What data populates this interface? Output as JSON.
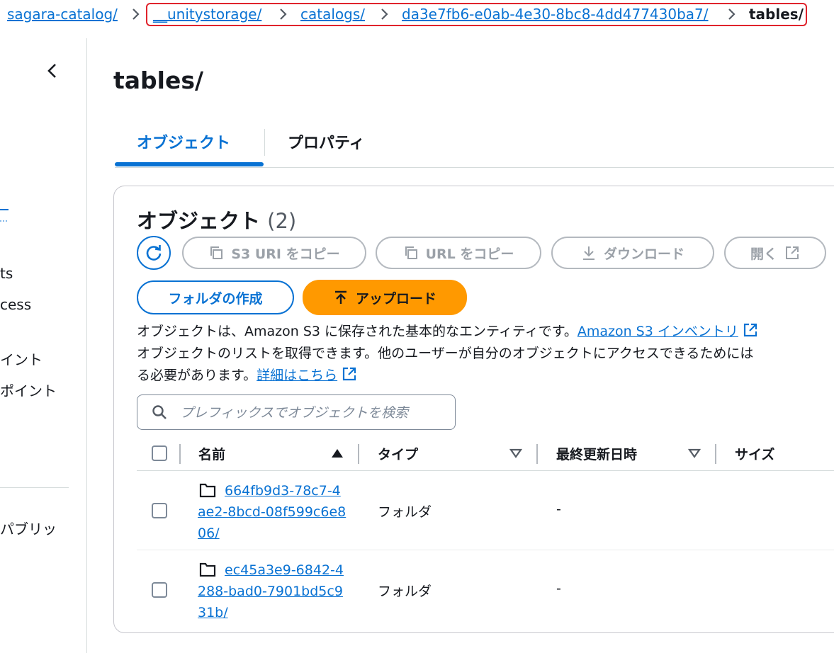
{
  "breadcrumb": {
    "items": [
      "sagara-catalog/",
      "__unitystorage/",
      "catalogs/",
      "da3e7fb6-e0ab-4e30-8bc8-4dd477430ba7/"
    ],
    "current": "tables/"
  },
  "sidebar": {
    "items": [
      "ts",
      "cess",
      "イント",
      "ポイント",
      "パブリッ"
    ]
  },
  "page": {
    "title": "tables/"
  },
  "tabs": [
    {
      "label": "オブジェクト",
      "active": true
    },
    {
      "label": "プロパティ",
      "active": false
    }
  ],
  "objects_panel": {
    "title": "オブジェクト",
    "count": "(2)",
    "buttons": {
      "copy_s3_uri": "S3 URI をコピー",
      "copy_url": "URL をコピー",
      "download": "ダウンロード",
      "open": "開く",
      "create_folder": "フォルダの作成",
      "upload": "アップロード"
    },
    "description": {
      "line1": "オブジェクトは、Amazon S3 に保存された基本的なエンティティです。",
      "inventory_link": "Amazon S3 インベントリ",
      "line2": "オブジェクトのリストを取得できます。他のユーザーが自分のオブジェクトにアクセスできるためには",
      "line3": "る必要があります。",
      "details_link": "詳細はこちら"
    },
    "search": {
      "placeholder": "プレフィックスでオブジェクトを検索",
      "value": ""
    },
    "table": {
      "columns": {
        "name": "名前",
        "type": "タイプ",
        "modified": "最終更新日時",
        "size": "サイズ"
      },
      "rows": [
        {
          "name": "664fb9d3-78c7-4ae2-8bcd-08f599c6e806/",
          "type": "フォルダ",
          "modified": "-",
          "size": ""
        },
        {
          "name": "ec45a3e9-6842-4288-bad0-7901bd5c931b/",
          "type": "フォルダ",
          "modified": "-",
          "size": ""
        }
      ]
    }
  },
  "colors": {
    "link": "#0972d3",
    "primary_button": "#ff9900",
    "highlight": "#e0232c",
    "disabled": "#9ba1a8"
  },
  "icons": [
    "chevron-right-icon",
    "chevron-left-icon",
    "refresh-icon",
    "copy-icon",
    "download-icon",
    "external-link-icon",
    "upload-icon",
    "search-icon",
    "folder-icon",
    "sort-asc-icon",
    "sort-desc-icon"
  ]
}
